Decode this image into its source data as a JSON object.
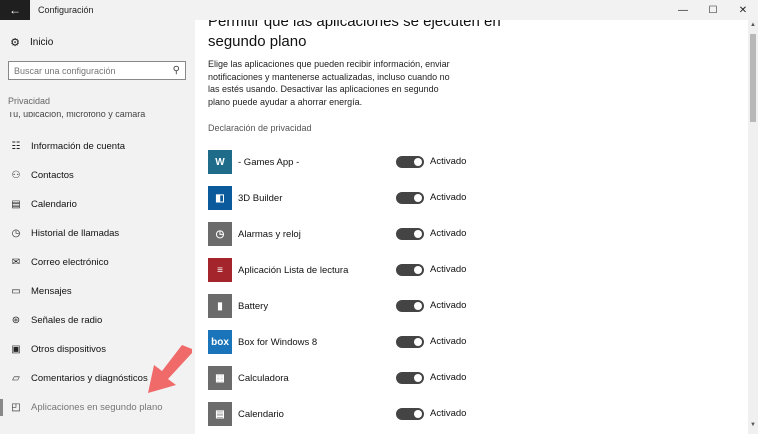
{
  "window": {
    "title": "Configuración",
    "back_icon": "←",
    "minimize_icon": "—",
    "maximize_icon": "☐",
    "close_icon": "✕"
  },
  "sidebar": {
    "home_label": "Inicio",
    "search_placeholder": "Buscar una configuración",
    "section_label": "Privacidad",
    "cutoff_text": "Tu, ubicación, micrófono y cámara",
    "items": [
      {
        "label": "Información de cuenta",
        "icon": "account-info-icon"
      },
      {
        "label": "Contactos",
        "icon": "contacts-icon"
      },
      {
        "label": "Calendario",
        "icon": "calendar-icon"
      },
      {
        "label": "Historial de llamadas",
        "icon": "call-history-icon"
      },
      {
        "label": "Correo electrónico",
        "icon": "email-icon"
      },
      {
        "label": "Mensajes",
        "icon": "messages-icon"
      },
      {
        "label": "Señales de radio",
        "icon": "radio-icon"
      },
      {
        "label": "Otros dispositivos",
        "icon": "devices-icon"
      },
      {
        "label": "Comentarios y diagnósticos",
        "icon": "feedback-icon"
      },
      {
        "label": "Aplicaciones en segundo plano",
        "icon": "background-apps-icon"
      }
    ]
  },
  "main": {
    "heading": "Permitir que las aplicaciones se ejecuten en segundo plano",
    "description": "Elige las aplicaciones que pueden recibir información, enviar notificaciones y mantenerse actualizadas, incluso cuando no las estés usando. Desactivar las aplicaciones en segundo plano puede ayudar a ahorrar energía.",
    "privacy_link": "Declaración de privacidad",
    "apps": [
      {
        "name": "- Games App -",
        "state": "Activado",
        "icon_color": "#1f6b8a",
        "icon_glyph": "W"
      },
      {
        "name": "3D Builder",
        "state": "Activado",
        "icon_color": "#0a5a9c",
        "icon_glyph": "◧"
      },
      {
        "name": "Alarmas y reloj",
        "state": "Activado",
        "icon_color": "#6b6b6b",
        "icon_glyph": "◷"
      },
      {
        "name": "Aplicación Lista de lectura",
        "state": "Activado",
        "icon_color": "#a4262c",
        "icon_glyph": "≡"
      },
      {
        "name": "Battery",
        "state": "Activado",
        "icon_color": "#6b6b6b",
        "icon_glyph": "▮"
      },
      {
        "name": "Box for Windows 8",
        "state": "Activado",
        "icon_color": "#1a74ba",
        "icon_glyph": "box"
      },
      {
        "name": "Calculadora",
        "state": "Activado",
        "icon_color": "#6b6b6b",
        "icon_glyph": "▦"
      },
      {
        "name": "Calendario",
        "state": "Activado",
        "icon_color": "#6b6b6b",
        "icon_glyph": "▤"
      }
    ]
  },
  "colors": {
    "sidebar_bg": "#f2f2f2",
    "toggle_on": "#444444",
    "arrow": "#f06a6a"
  }
}
